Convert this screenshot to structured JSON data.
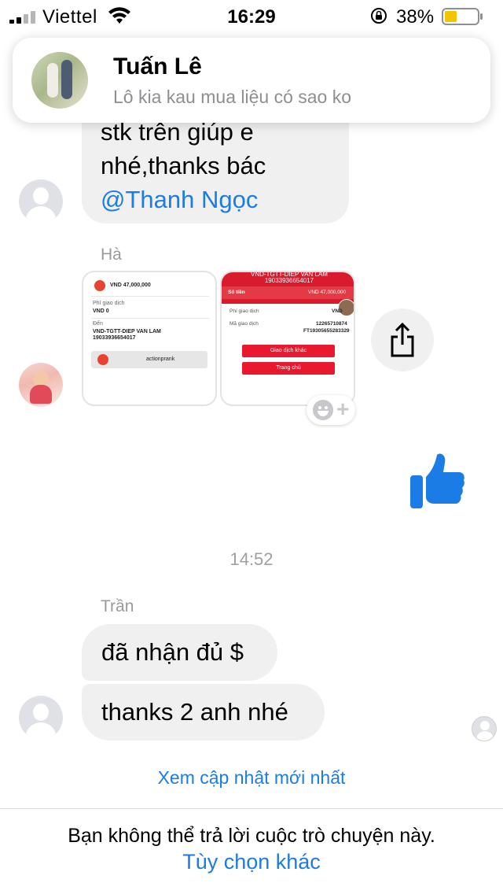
{
  "status_bar": {
    "carrier": "Viettel",
    "time": "16:29",
    "battery": "38%",
    "battery_level": 0.38,
    "icons": [
      "signal-icon",
      "wifi-icon",
      "rotation-lock-icon",
      "battery-icon"
    ]
  },
  "notification": {
    "sender": "Tuấn Lê",
    "message": "Lô kia kau mua liệu có sao ko"
  },
  "messages": {
    "partial_lines": [
      "stk trên giúp e",
      "nhé,thanks bác"
    ],
    "mention": "@Thanh Ngọc",
    "image_sender": "Hà",
    "timestamp": "14:52",
    "text_sender": "Trần",
    "bubble_1": "đã nhận đủ $",
    "bubble_2": "thanks 2 anh nhé"
  },
  "receipt_1": {
    "amount": "VND 47,000,000",
    "fee_label": "Phí giao dịch",
    "fee_value": "VND 0",
    "to_label": "Đến",
    "to_name": "VND-TGTT-DIEP VAN LAM",
    "to_account": "19033936654017",
    "bar_label": "actionprank"
  },
  "receipt_2": {
    "header_name": "VND-TGTT-DIEP VAN LAM",
    "header_account": "19033936654017",
    "amount_label": "Số tiền",
    "amount": "VND 47,000,000",
    "fee_label": "Phí giao dịch",
    "fee_value": "VND",
    "code_label": "Mã giao dịch",
    "code_1": "12265710874",
    "code_2": "FT19305655283329",
    "btn_other": "Giao dịch khác",
    "btn_home": "Trang chủ"
  },
  "footer": {
    "latest": "Xem cập nhật mới nhất",
    "notice": "Bạn không thể trả lời cuộc trò chuyện này.",
    "more_options": "Tùy chọn khác"
  },
  "colors": {
    "accent": "#1b7ce6",
    "bubble": "#f0f0f0",
    "receipt_red": "#d81b2d"
  }
}
